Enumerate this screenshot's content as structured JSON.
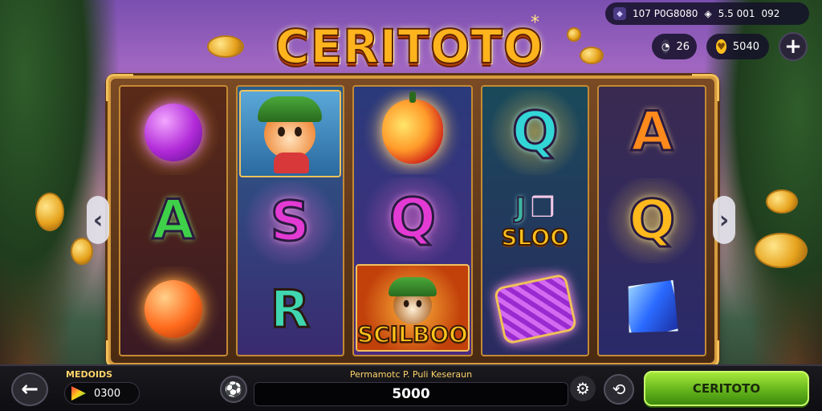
{
  "title": {
    "text": "CERITOTO",
    "star": "*"
  },
  "hud": {
    "top_bar": {
      "id_text": "107 P0G8080",
      "diamond_value": "5.5 001",
      "time_text": "092"
    },
    "pill_left": {
      "value": "26",
      "icon": "clock-icon"
    },
    "pill_coins": {
      "value": "5040",
      "icon": "coin-heart-icon"
    },
    "plus_label": "+"
  },
  "reels": {
    "r1": [
      "purple-orb",
      "A",
      "orange-orb"
    ],
    "r2": [
      "hamster-character",
      "S",
      "R"
    ],
    "r3": [
      "tomato-fruit",
      "Q",
      "SCILBOO"
    ],
    "r4": [
      "Q",
      "J SLOO",
      "treasure-bag"
    ],
    "r5": [
      "A",
      "Q",
      "blue-gem"
    ]
  },
  "symbols": {
    "r1c2": "A",
    "r2c2": "S",
    "r2c3": "R",
    "r3c2": "Q",
    "r3c3_text": "SCILBOO",
    "r4c1": "Q",
    "r4c2_letter": "J",
    "r4c2_text": "SLOO",
    "r5c1": "A",
    "r5c2": "Q"
  },
  "bottom": {
    "balance_label": "MEDOIDS",
    "balance_value": "0300",
    "center_label": "Permamotc P. Puli Keseraun",
    "center_value": "5000",
    "spin_label": "CERITOTO"
  },
  "colors": {
    "accent": "#ffb41e",
    "spin_green": "#5fb01a",
    "frame_gold": "#d69b3e"
  }
}
